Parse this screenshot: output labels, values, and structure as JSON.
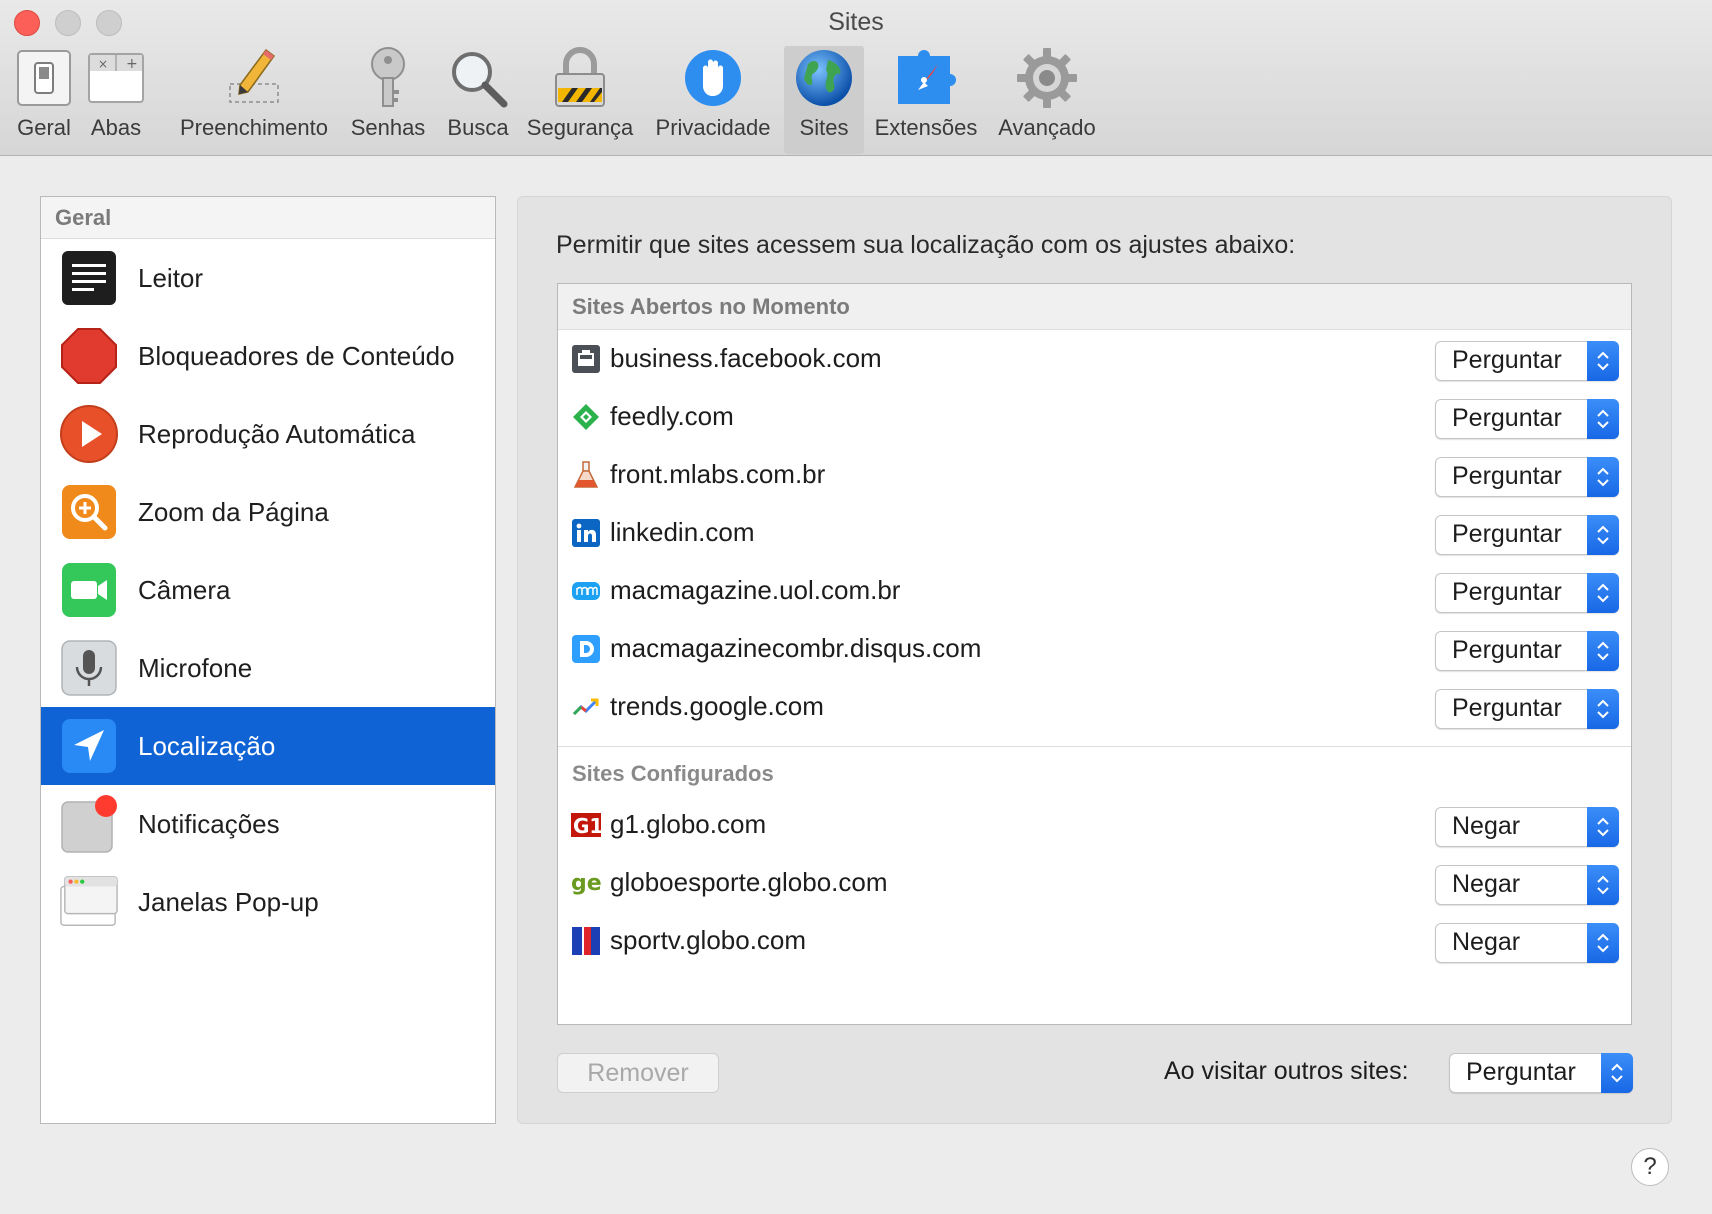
{
  "window": {
    "title": "Sites"
  },
  "toolbar": {
    "items": [
      {
        "label": "Geral",
        "icon": "switch-icon"
      },
      {
        "label": "Abas",
        "icon": "tabs-icon"
      },
      {
        "label": "Preenchimento",
        "icon": "pencil-icon"
      },
      {
        "label": "Senhas",
        "icon": "key-icon"
      },
      {
        "label": "Busca",
        "icon": "magnifier-icon"
      },
      {
        "label": "Segurança",
        "icon": "lock-icon"
      },
      {
        "label": "Privacidade",
        "icon": "hand-icon"
      },
      {
        "label": "Sites",
        "icon": "globe-icon",
        "active": true
      },
      {
        "label": "Extensões",
        "icon": "puzzle-compass-icon"
      },
      {
        "label": "Avançado",
        "icon": "gear-icon"
      }
    ]
  },
  "sidebar": {
    "header": "Geral",
    "items": [
      {
        "label": "Leitor",
        "icon": "reader-icon"
      },
      {
        "label": "Bloqueadores de Conteúdo",
        "icon": "stop-sign-icon"
      },
      {
        "label": "Reprodução Automática",
        "icon": "play-icon"
      },
      {
        "label": "Zoom da Página",
        "icon": "zoom-icon"
      },
      {
        "label": "Câmera",
        "icon": "camera-icon"
      },
      {
        "label": "Microfone",
        "icon": "microphone-icon"
      },
      {
        "label": "Localização",
        "icon": "location-arrow-icon",
        "selected": true
      },
      {
        "label": "Notificações",
        "icon": "notification-icon"
      },
      {
        "label": "Janelas Pop-up",
        "icon": "popup-window-icon"
      }
    ]
  },
  "panel": {
    "description": "Permitir que sites acessem sua localização com os ajustes abaixo:",
    "open_sites_header": "Sites Abertos no Momento",
    "open_sites": [
      {
        "name": "business.facebook.com",
        "value": "Perguntar",
        "icon": "facebook-business-icon"
      },
      {
        "name": "feedly.com",
        "value": "Perguntar",
        "icon": "feedly-icon"
      },
      {
        "name": "front.mlabs.com.br",
        "value": "Perguntar",
        "icon": "mlabs-flask-icon"
      },
      {
        "name": "linkedin.com",
        "value": "Perguntar",
        "icon": "linkedin-icon"
      },
      {
        "name": "macmagazine.uol.com.br",
        "value": "Perguntar",
        "icon": "macmagazine-icon"
      },
      {
        "name": "macmagazinecombr.disqus.com",
        "value": "Perguntar",
        "icon": "disqus-icon"
      },
      {
        "name": "trends.google.com",
        "value": "Perguntar",
        "icon": "google-trends-icon"
      }
    ],
    "configured_header": "Sites Configurados",
    "configured_sites": [
      {
        "name": "g1.globo.com",
        "value": "Negar",
        "icon": "g1-icon"
      },
      {
        "name": "globoesporte.globo.com",
        "value": "Negar",
        "icon": "globoesporte-icon"
      },
      {
        "name": "sportv.globo.com",
        "value": "Negar",
        "icon": "sportv-icon"
      }
    ],
    "remove_label": "Remover",
    "other_sites_label": "Ao visitar outros sites:",
    "other_sites_value": "Perguntar"
  },
  "help": {
    "label": "?"
  },
  "colors": {
    "selection": "#0f63d4",
    "popup_accent": "#1868e6",
    "close": "#fc5f57"
  }
}
